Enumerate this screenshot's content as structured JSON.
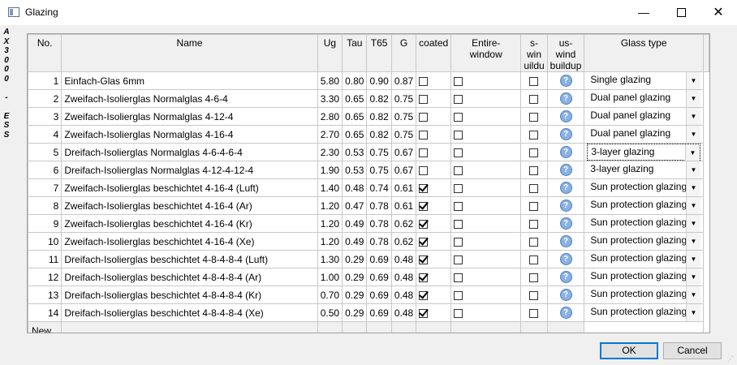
{
  "window": {
    "title": "Glazing",
    "min_glyph": "—",
    "close_glyph": "✕",
    "side_text": "AX3000 - ESS"
  },
  "columns": [
    {
      "label": "No."
    },
    {
      "label": "Name"
    },
    {
      "label": "Ug"
    },
    {
      "label": "Tau"
    },
    {
      "label": "T65"
    },
    {
      "label": "G"
    },
    {
      "label": "coated"
    },
    {
      "label": "Entire-\nwindow"
    },
    {
      "label": "s-win\nuildu"
    },
    {
      "label": "us-wind\nbuildup"
    },
    {
      "label": "Glass type"
    }
  ],
  "rows": [
    {
      "no": "1",
      "name": "Einfach-Glas 6mm",
      "ug": "5.80",
      "tau": "0.80",
      "t65": "0.90",
      "g": "0.87",
      "coated": false,
      "glass_type": "Single glazing"
    },
    {
      "no": "2",
      "name": "Zweifach-Isolierglas Normalglas 4-6-4",
      "ug": "3.30",
      "tau": "0.65",
      "t65": "0.82",
      "g": "0.75",
      "coated": false,
      "glass_type": "Dual panel glazing"
    },
    {
      "no": "3",
      "name": "Zweifach-Isolierglas Normalglas 4-12-4",
      "ug": "2.80",
      "tau": "0.65",
      "t65": "0.82",
      "g": "0.75",
      "coated": false,
      "glass_type": "Dual panel glazing"
    },
    {
      "no": "4",
      "name": "Zweifach-Isolierglas Normalglas 4-16-4",
      "ug": "2.70",
      "tau": "0.65",
      "t65": "0.82",
      "g": "0.75",
      "coated": false,
      "glass_type": "Dual panel glazing"
    },
    {
      "no": "5",
      "name": "Dreifach-Isolierglas Normalglas 4-6-4-6-4",
      "ug": "2.30",
      "tau": "0.53",
      "t65": "0.75",
      "g": "0.67",
      "coated": false,
      "glass_type": "3-layer glazing",
      "focused": true
    },
    {
      "no": "6",
      "name": "Dreifach-Isolierglas Normalglas 4-12-4-12-4",
      "ug": "1.90",
      "tau": "0.53",
      "t65": "0.75",
      "g": "0.67",
      "coated": false,
      "glass_type": "3-layer glazing"
    },
    {
      "no": "7",
      "name": "Zweifach-Isolierglas beschichtet 4-16-4 (Luft)",
      "ug": "1.40",
      "tau": "0.48",
      "t65": "0.74",
      "g": "0.61",
      "coated": true,
      "glass_type": "Sun protection glazing"
    },
    {
      "no": "8",
      "name": "Zweifach-Isolierglas beschichtet 4-16-4 (Ar)",
      "ug": "1.20",
      "tau": "0.47",
      "t65": "0.78",
      "g": "0.61",
      "coated": true,
      "glass_type": "Sun protection glazing"
    },
    {
      "no": "9",
      "name": "Zweifach-Isolierglas beschichtet 4-16-4 (Kr)",
      "ug": "1.20",
      "tau": "0.49",
      "t65": "0.78",
      "g": "0.62",
      "coated": true,
      "glass_type": "Sun protection glazing"
    },
    {
      "no": "10",
      "name": "Zweifach-Isolierglas beschichtet 4-16-4 (Xe)",
      "ug": "1.20",
      "tau": "0.49",
      "t65": "0.78",
      "g": "0.62",
      "coated": true,
      "glass_type": "Sun protection glazing"
    },
    {
      "no": "11",
      "name": "Dreifach-Isolierglas beschichtet 4-8-4-8-4 (Luft)",
      "ug": "1.30",
      "tau": "0.29",
      "t65": "0.69",
      "g": "0.48",
      "coated": true,
      "glass_type": "Sun protection glazing"
    },
    {
      "no": "12",
      "name": "Dreifach-Isolierglas beschichtet 4-8-4-8-4 (Ar)",
      "ug": "1.00",
      "tau": "0.29",
      "t65": "0.69",
      "g": "0.48",
      "coated": true,
      "glass_type": "Sun protection glazing"
    },
    {
      "no": "13",
      "name": "Dreifach-Isolierglas beschichtet 4-8-4-8-4 (Kr)",
      "ug": "0.70",
      "tau": "0.29",
      "t65": "0.69",
      "g": "0.48",
      "coated": true,
      "glass_type": "Sun protection glazing"
    },
    {
      "no": "14",
      "name": "Dreifach-Isolierglas beschichtet 4-8-4-8-4 (Xe)",
      "ug": "0.50",
      "tau": "0.29",
      "t65": "0.69",
      "g": "0.48",
      "coated": true,
      "glass_type": "Sun protection glazing"
    }
  ],
  "new_row_label": "New...",
  "help_glyph": "?",
  "combo_arrow": "▼",
  "buttons": {
    "ok": "OK",
    "cancel": "Cancel"
  },
  "colors": {
    "accent": "#0078d7",
    "help_icon": "#8ab1e2"
  }
}
